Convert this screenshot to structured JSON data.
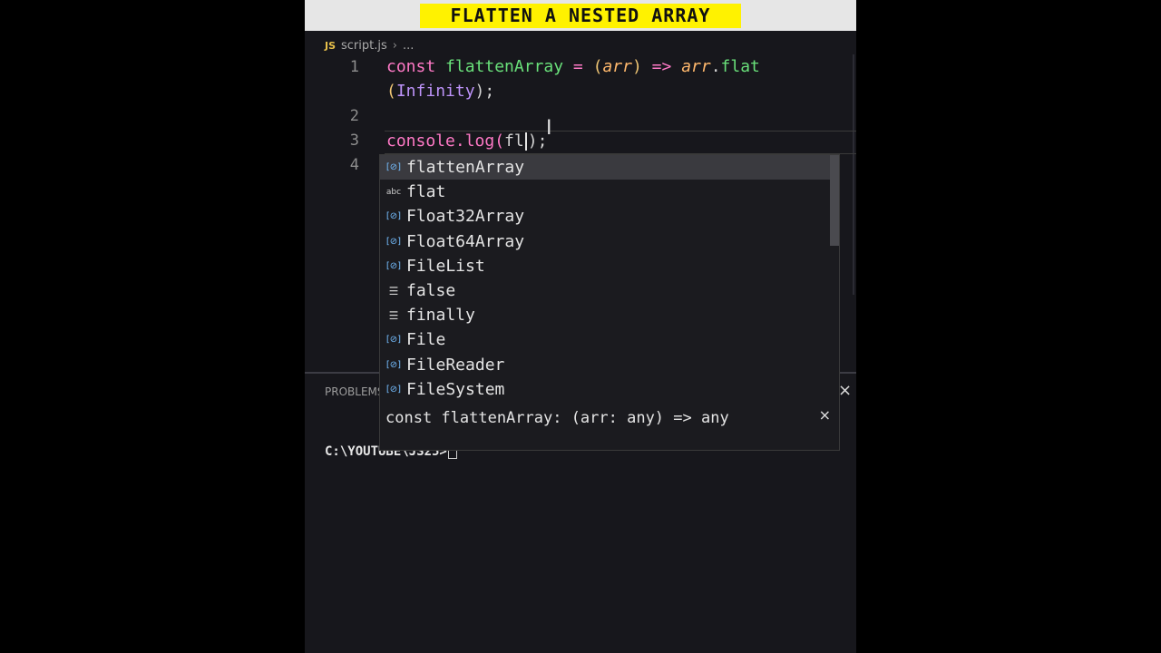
{
  "title": "FLATTEN A NESTED ARRAY",
  "breadcrumb": {
    "file": "script.js",
    "more": "..."
  },
  "lines": [
    "1",
    "2",
    "3",
    "4"
  ],
  "code": {
    "line1_kw": "const",
    "line1_name": "flattenArray",
    "line1_eq": "=",
    "line1_open": "(",
    "line1_param": "arr",
    "line1_close": ")",
    "line1_arrow": "=>",
    "line1_obj": "arr",
    "line1_dot": ".",
    "line1_method": "flat",
    "line1b_open": "(",
    "line1b_arg": "Infinity",
    "line1b_close": ");",
    "line3_a": "console.log(",
    "line3_typed": "fl",
    "line3_b": ");"
  },
  "suggestions": [
    {
      "label": "flattenArray",
      "kind": "variable",
      "icon": "[⊘]"
    },
    {
      "label": "flat",
      "kind": "text",
      "icon": "abc"
    },
    {
      "label": "Float32Array",
      "kind": "variable",
      "icon": "[⊘]"
    },
    {
      "label": "Float64Array",
      "kind": "variable",
      "icon": "[⊘]"
    },
    {
      "label": "FileList",
      "kind": "variable",
      "icon": "[⊘]"
    },
    {
      "label": "false",
      "kind": "keyword",
      "icon": "☰"
    },
    {
      "label": "finally",
      "kind": "keyword",
      "icon": "☰"
    },
    {
      "label": "File",
      "kind": "variable",
      "icon": "[⊘]"
    },
    {
      "label": "FileReader",
      "kind": "variable",
      "icon": "[⊘]"
    },
    {
      "label": "FileSystem",
      "kind": "variable",
      "icon": "[⊘]"
    }
  ],
  "details": {
    "signature": "const flattenArray: (arr: any) => any",
    "close": "×"
  },
  "panel": {
    "tab": "PROBLEMS",
    "close": "×"
  },
  "terminal": {
    "prompt": "C:\\YOUTUBE\\JS25>"
  }
}
